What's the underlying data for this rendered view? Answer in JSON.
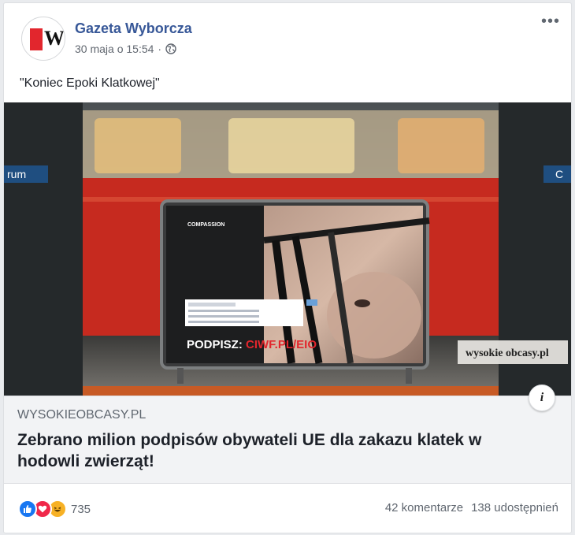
{
  "post": {
    "page_name": "Gazeta Wyborcza",
    "timestamp": "30 maja o 15:54",
    "separator": "·",
    "privacy_icon": "globe-icon",
    "more_icon": "more-options-icon",
    "more_label": "•••",
    "text": "\"Koniec Epoki Klatkowej\""
  },
  "avatar": {
    "logo_letter": "W",
    "brand_color": "#e2262d"
  },
  "image": {
    "station_sign_left": "rum",
    "station_sign_right": "C",
    "billboard_logo": "COMPASSION",
    "billboard_cta_prefix": "PODPISZ: ",
    "billboard_cta_link": "CIWF.PL/EIO",
    "watermark": "wysokie obcasy.pl",
    "info_label": "i"
  },
  "link_preview": {
    "domain": "WYSOKIEOBCASY.PL",
    "headline": "Zebrano milion podpisów obywateli UE dla zakazu klatek w hodowli zwierząt!"
  },
  "footer": {
    "reactions": [
      "like-icon",
      "love-icon",
      "haha-icon"
    ],
    "reaction_count": "735",
    "comments": "42 komentarze",
    "shares": "138 udostępnień"
  },
  "colors": {
    "link_blue": "#385898",
    "train_red": "#c62a1f",
    "cta_red": "#e2262d"
  }
}
